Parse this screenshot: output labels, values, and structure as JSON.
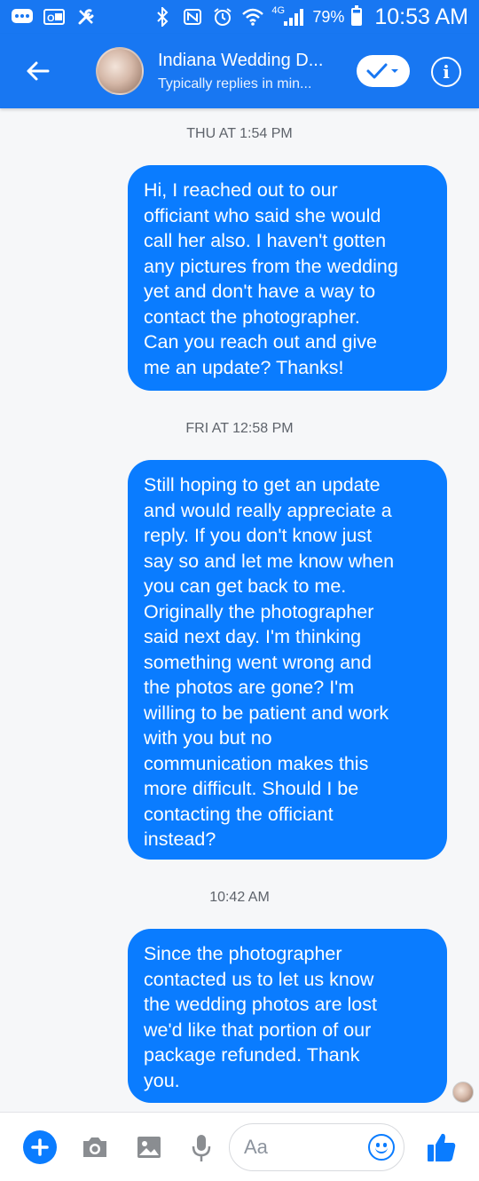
{
  "statusbar": {
    "battery": "79%",
    "time": "10:53 AM",
    "network": "4G"
  },
  "header": {
    "title": "Indiana Wedding D...",
    "subtitle": "Typically replies in min..."
  },
  "messages": [
    {
      "timestamp": "THU AT 1:54 PM",
      "text": "Hi, I reached out to our\nofficiant who said she would\ncall her also.  I haven't gotten\nany pictures from the wedding\nyet and don't have a way to\ncontact the photographer.\nCan you reach out and give\nme an update?  Thanks!"
    },
    {
      "timestamp": "FRI AT 12:58 PM",
      "text": "Still hoping to get an update\nand would really appreciate a\nreply.  If you don't know just\nsay so and let me know when\nyou can get back to me.\nOriginally the photographer\nsaid next day.  I'm thinking\nsomething went wrong and\nthe photos are gone?  I'm\nwilling to be patient and work\nwith you but no\ncommunication makes this\nmore difficult.  Should I be\ncontacting the officiant\ninstead?"
    },
    {
      "timestamp": "10:42 AM",
      "text": "Since the photographer\ncontacted us to let us know\nthe wedding photos are lost\nwe'd like that portion of our\npackage refunded.  Thank\nyou."
    }
  ],
  "composer": {
    "placeholder": "Aa"
  },
  "colors": {
    "brand": "#1877f2",
    "bubble": "#0a7cff"
  }
}
